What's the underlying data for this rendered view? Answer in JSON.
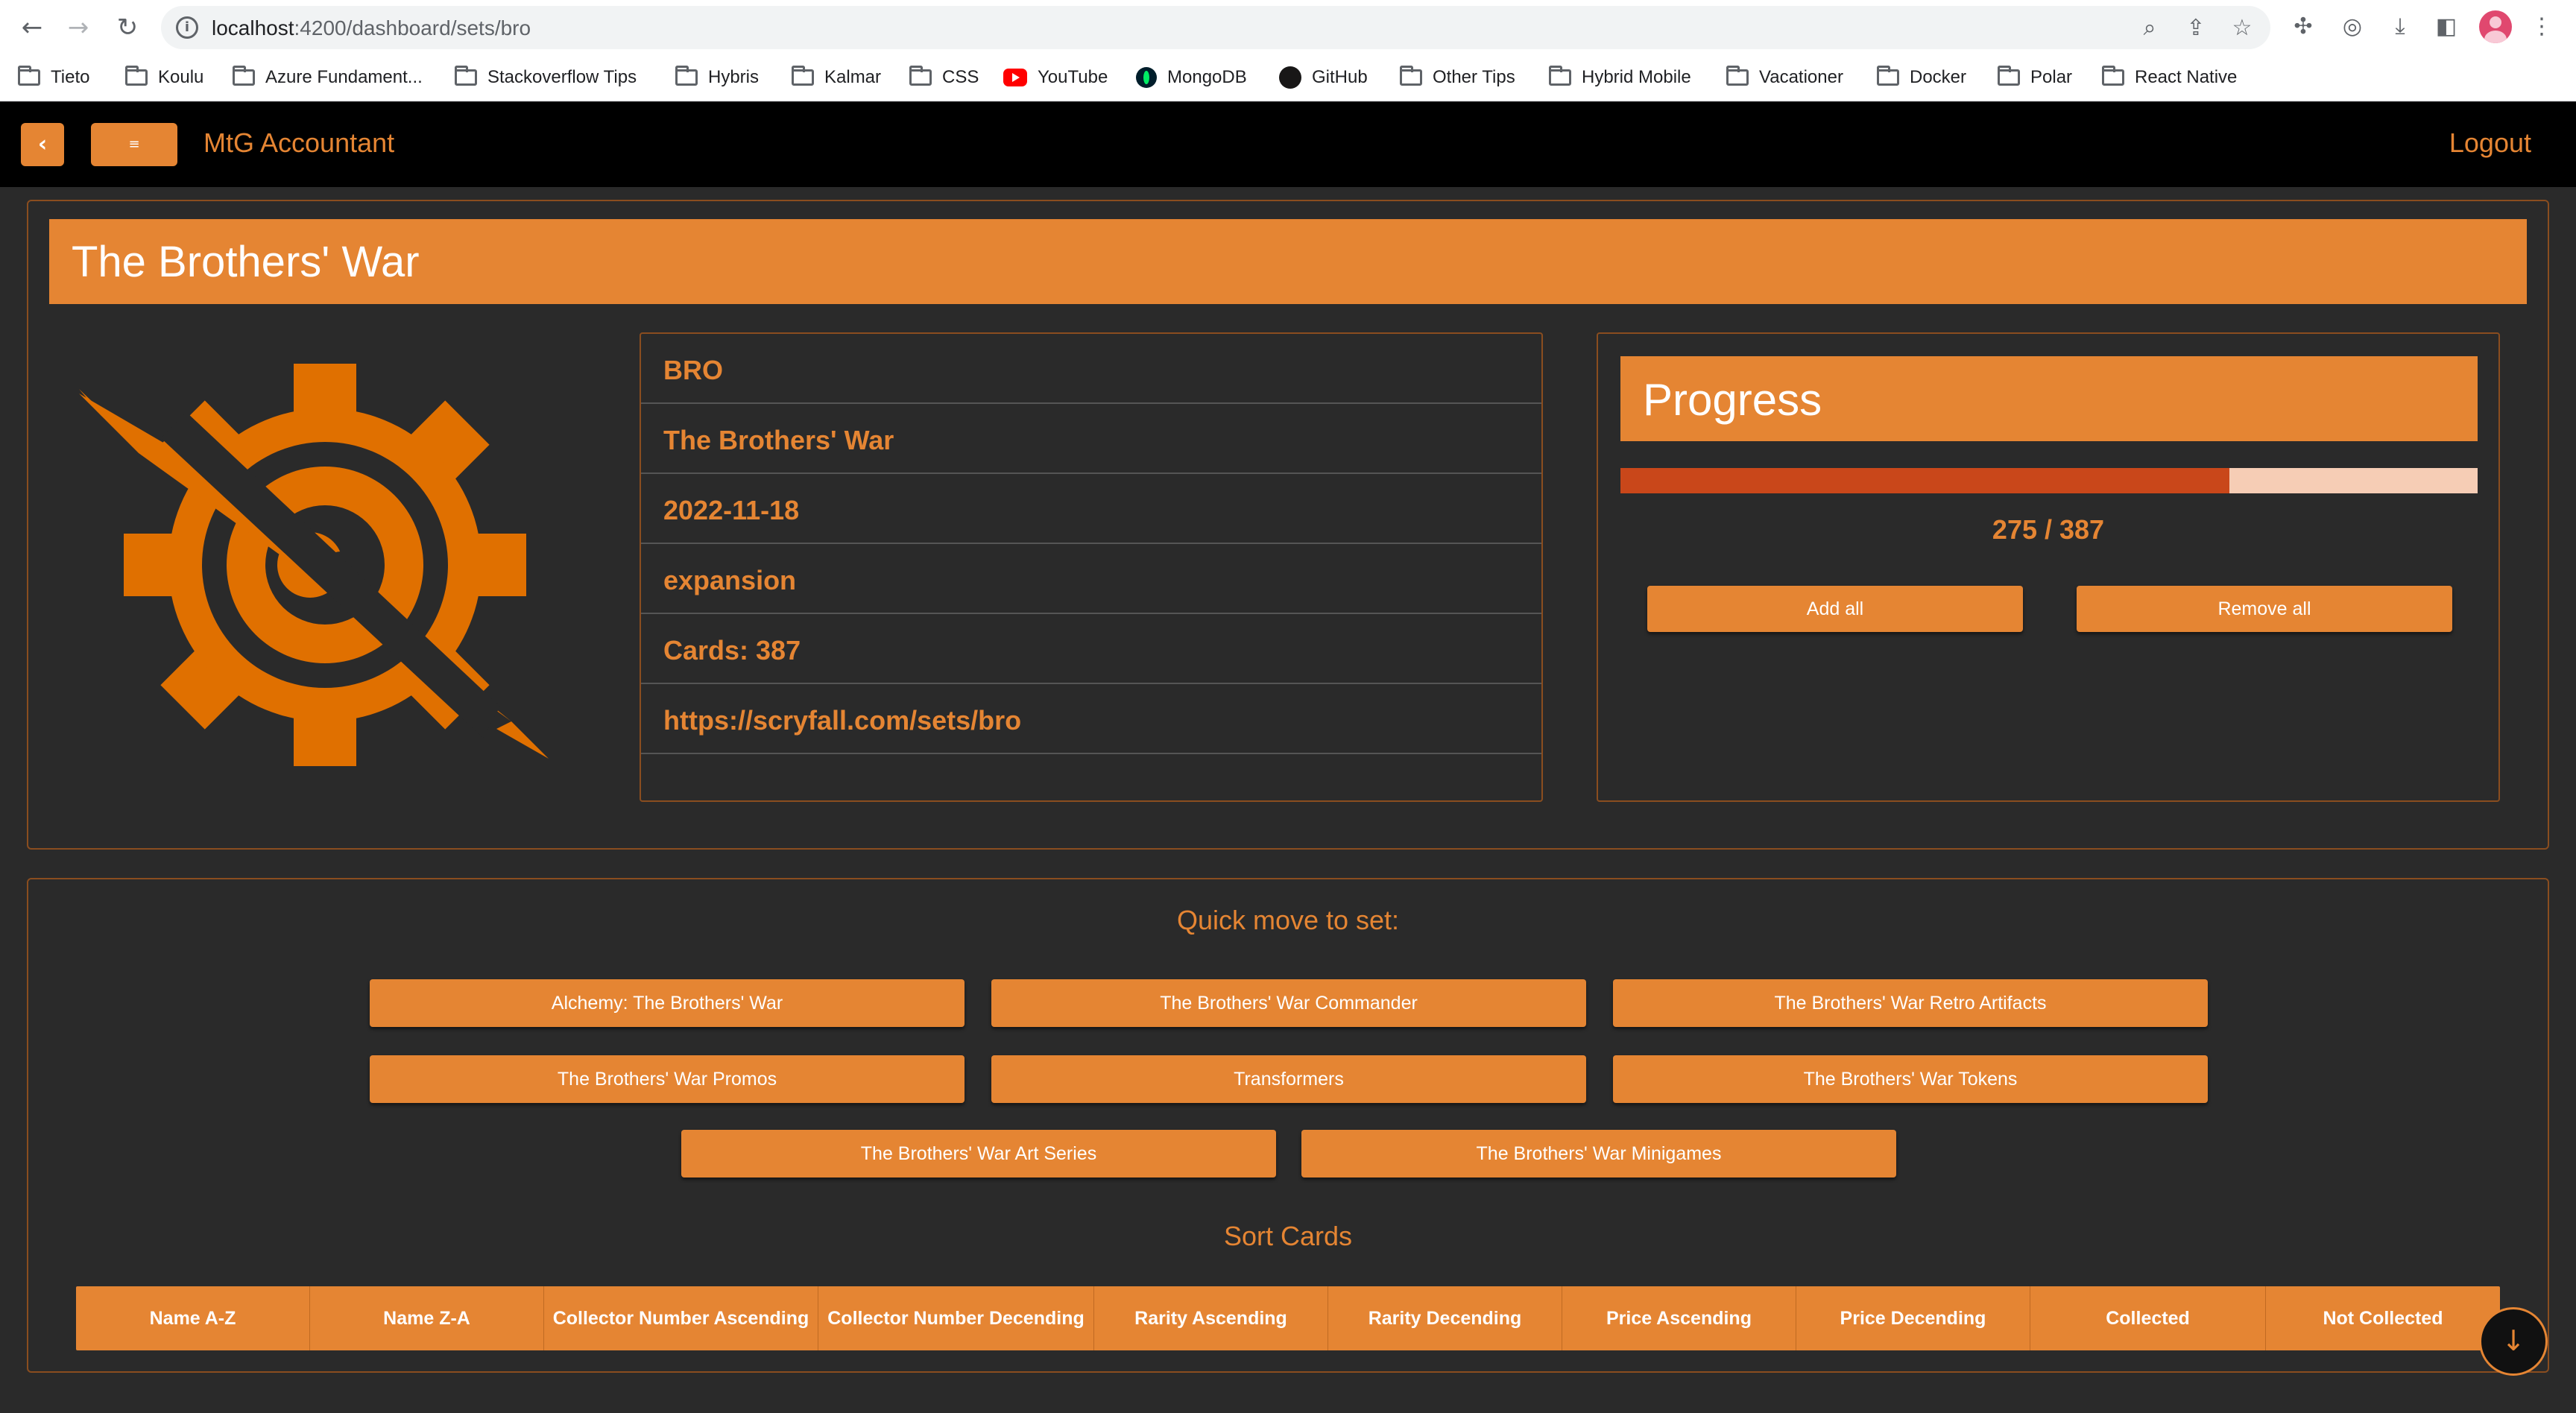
{
  "browser": {
    "url_host": "localhost",
    "url_path": ":4200/dashboard/sets/bro",
    "bookmarks": [
      {
        "label": "Tieto",
        "icon": "folder-icon"
      },
      {
        "label": "Koulu",
        "icon": "folder-icon"
      },
      {
        "label": "Azure Fundament...",
        "icon": "folder-icon"
      },
      {
        "label": "Stackoverflow Tips",
        "icon": "folder-icon"
      },
      {
        "label": "Hybris",
        "icon": "folder-icon"
      },
      {
        "label": "Kalmar",
        "icon": "folder-icon"
      },
      {
        "label": "CSS",
        "icon": "folder-icon"
      },
      {
        "label": "YouTube",
        "icon": "youtube-icon"
      },
      {
        "label": "MongoDB",
        "icon": "mongodb-icon"
      },
      {
        "label": "GitHub",
        "icon": "github-icon"
      },
      {
        "label": "Other Tips",
        "icon": "folder-icon"
      },
      {
        "label": "Hybrid Mobile",
        "icon": "folder-icon"
      },
      {
        "label": "Vacationer",
        "icon": "folder-icon"
      },
      {
        "label": "Docker",
        "icon": "folder-icon"
      },
      {
        "label": "Polar",
        "icon": "folder-icon"
      },
      {
        "label": "React Native",
        "icon": "folder-icon"
      }
    ]
  },
  "toolbar": {
    "back_label": "‹",
    "menu_label": "≡",
    "title": "MtG Accountant",
    "logout_label": "Logout"
  },
  "set": {
    "name": "The Brothers' War",
    "code": "BRO",
    "release_date": "2022-11-18",
    "type": "expansion",
    "cards_label": "Cards: 387",
    "url": "https://scryfall.com/sets/bro"
  },
  "progress": {
    "title": "Progress",
    "collected": 275,
    "total": 387,
    "count_label": "275 / 387",
    "add_all_label": "Add all",
    "remove_all_label": "Remove all"
  },
  "quick_move": {
    "title": "Quick move to set:",
    "sets": [
      "Alchemy: The Brothers' War",
      "The Brothers' War Commander",
      "The Brothers' War Retro Artifacts",
      "The Brothers' War Promos",
      "Transformers",
      "The Brothers' War Tokens",
      "The Brothers' War Art Series",
      "The Brothers' War Minigames"
    ]
  },
  "sort": {
    "title": "Sort Cards",
    "options": [
      "Name A-Z",
      "Name Z-A",
      "Collector Number Ascending",
      "Collector Number Decending",
      "Rarity Ascending",
      "Rarity Decending",
      "Price Ascending",
      "Price Decending",
      "Collected",
      "Not Collected"
    ]
  },
  "fab_label": "↓",
  "colors": {
    "accent": "#e58533",
    "background": "#2a2a2a",
    "progress_fill": "#c9471a",
    "progress_track": "#f6cdb5"
  }
}
